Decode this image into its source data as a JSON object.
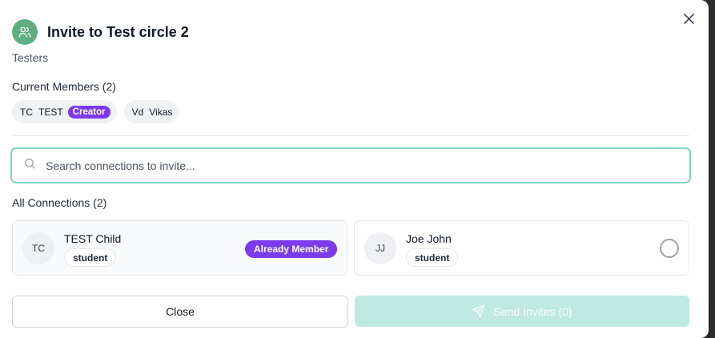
{
  "dialog": {
    "title": "Invite to Test circle 2",
    "subtitle": "Testers",
    "header_icon": "users-icon",
    "close_icon": "close-icon"
  },
  "current_members": {
    "label": "Current Members (2)",
    "items": [
      {
        "initials": "TC",
        "name": "TEST",
        "badge": "Creator"
      },
      {
        "initials": "Vd",
        "name": "Vikas"
      }
    ]
  },
  "search": {
    "placeholder": "Search connections to invite...",
    "value": "",
    "icon": "search-icon"
  },
  "connections": {
    "label": "All Connections (2)",
    "items": [
      {
        "initials": "TC",
        "name": "TEST Child",
        "role": "student",
        "status": "Already Member"
      },
      {
        "initials": "JJ",
        "name": "Joe John",
        "role": "student",
        "selected": false
      }
    ]
  },
  "footer": {
    "close_label": "Close",
    "send_label": "Send Invites (0)",
    "send_icon": "send-icon"
  },
  "colors": {
    "accent_green": "#5fae82",
    "purple_badge": "#7c3aed",
    "search_border": "#7fd5c1",
    "send_disabled_bg": "#bfe9e1"
  }
}
